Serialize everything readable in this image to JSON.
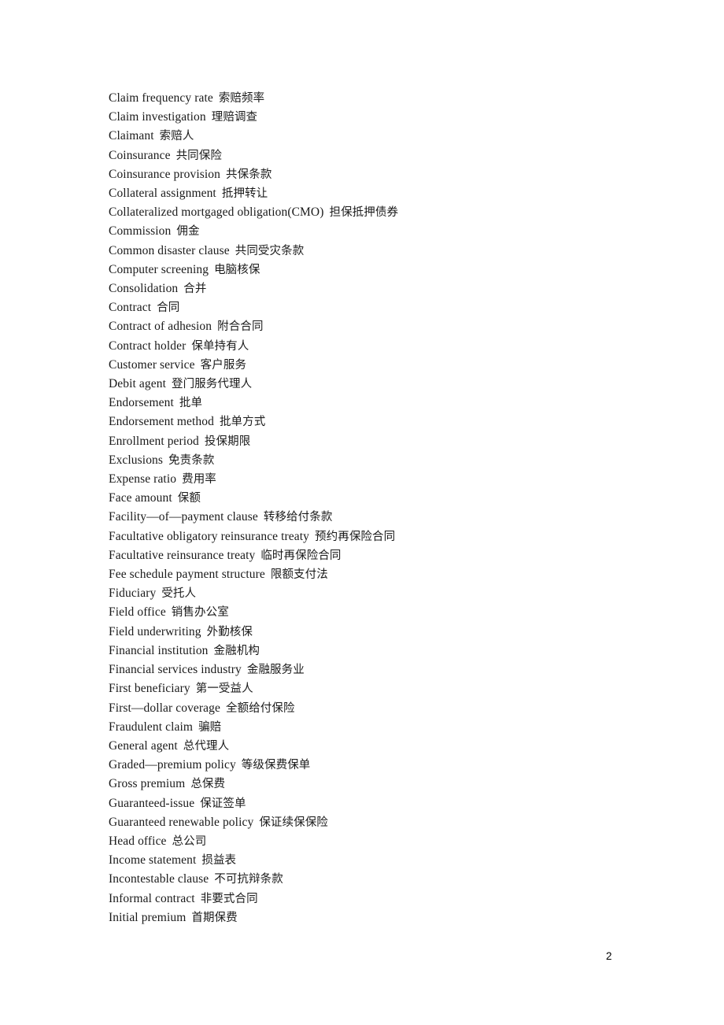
{
  "document": {
    "type": "bilingual-glossary",
    "page_number": "2",
    "entries": [
      {
        "term": "Claim frequency rate",
        "gloss": "索赔频率"
      },
      {
        "term": "Claim investigation",
        "gloss": "理赔调查"
      },
      {
        "term": "Claimant",
        "gloss": "索赔人"
      },
      {
        "term": "Coinsurance",
        "gloss": "共同保险"
      },
      {
        "term": "Coinsurance provision",
        "gloss": "共保条款"
      },
      {
        "term": "Collateral assignment",
        "gloss": "抵押转让"
      },
      {
        "term": "Collateralized mortgaged obligation(CMO)",
        "gloss": "担保抵押债券"
      },
      {
        "term": "Commission",
        "gloss": "佣金"
      },
      {
        "term": "Common disaster clause",
        "gloss": "共同受灾条款"
      },
      {
        "term": "Computer screening",
        "gloss": "电脑核保"
      },
      {
        "term": "Consolidation",
        "gloss": "合并"
      },
      {
        "term": "Contract",
        "gloss": "合同"
      },
      {
        "term": "Contract of adhesion",
        "gloss": "附合合同"
      },
      {
        "term": "Contract holder",
        "gloss": "保单持有人"
      },
      {
        "term": "Customer service",
        "gloss": "客户服务"
      },
      {
        "term": "Debit agent",
        "gloss": "登门服务代理人"
      },
      {
        "term": "Endorsement",
        "gloss": "批单"
      },
      {
        "term": "Endorsement method",
        "gloss": "批单方式"
      },
      {
        "term": "Enrollment period",
        "gloss": "投保期限"
      },
      {
        "term": "Exclusions",
        "gloss": "免责条款"
      },
      {
        "term": "Expense ratio",
        "gloss": "费用率"
      },
      {
        "term": "Face amount",
        "gloss": "保额"
      },
      {
        "term": "Facility—of—payment clause",
        "gloss": "转移给付条款"
      },
      {
        "term": "Facultative obligatory reinsurance treaty",
        "gloss": "预约再保险合同"
      },
      {
        "term": "Facultative reinsurance treaty",
        "gloss": "临时再保险合同"
      },
      {
        "term": "Fee schedule payment structure",
        "gloss": "限额支付法"
      },
      {
        "term": "Fiduciary",
        "gloss": "受托人"
      },
      {
        "term": "Field office",
        "gloss": "销售办公室"
      },
      {
        "term": "Field underwriting",
        "gloss": "外勤核保"
      },
      {
        "term": "Financial institution",
        "gloss": "金融机构"
      },
      {
        "term": "Financial services industry",
        "gloss": "金融服务业"
      },
      {
        "term": "First beneficiary",
        "gloss": "第一受益人"
      },
      {
        "term": "First—dollar coverage",
        "gloss": "全额给付保险"
      },
      {
        "term": "Fraudulent claim",
        "gloss": "骗赔"
      },
      {
        "term": "General agent",
        "gloss": "总代理人"
      },
      {
        "term": "Graded—premium policy",
        "gloss": "等级保费保单"
      },
      {
        "term": "Gross premium",
        "gloss": "总保费"
      },
      {
        "term": "Guaranteed-issue",
        "gloss": "保证签单"
      },
      {
        "term": "Guaranteed renewable policy",
        "gloss": "保证续保保险"
      },
      {
        "term": "Head office",
        "gloss": "总公司"
      },
      {
        "term": "Income statement",
        "gloss": "损益表"
      },
      {
        "term": "Incontestable clause",
        "gloss": "不可抗辩条款"
      },
      {
        "term": "Informal contract",
        "gloss": "非要式合同"
      },
      {
        "term": "Initial premium",
        "gloss": "首期保费"
      }
    ]
  }
}
